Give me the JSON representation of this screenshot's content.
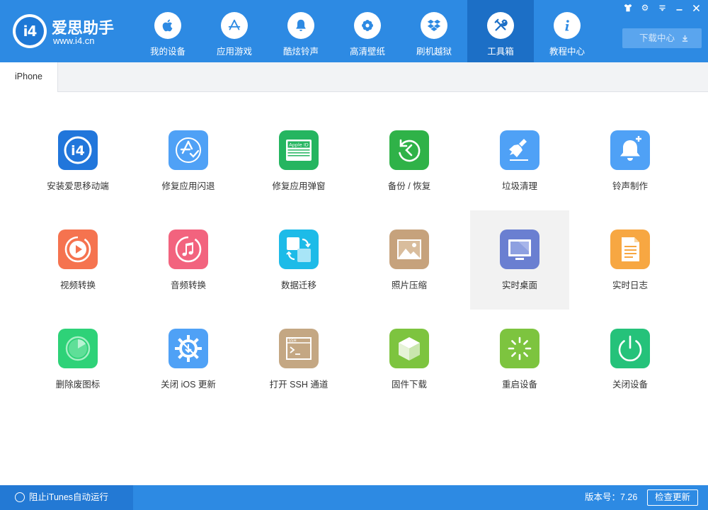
{
  "app": {
    "name": "爱思助手",
    "url": "www.i4.cn",
    "badge": "i4"
  },
  "nav": [
    {
      "label": "我的设备",
      "icon": "apple-icon"
    },
    {
      "label": "应用游戏",
      "icon": "app-store-icon"
    },
    {
      "label": "酷炫铃声",
      "icon": "bell-icon"
    },
    {
      "label": "高清壁纸",
      "icon": "flower-icon"
    },
    {
      "label": "刷机越狱",
      "icon": "dropbox-icon"
    },
    {
      "label": "工具箱",
      "icon": "tools-icon",
      "active": true
    },
    {
      "label": "教程中心",
      "icon": "info-icon"
    }
  ],
  "window_controls": [
    {
      "name": "skin-button",
      "glyph": "👕"
    },
    {
      "name": "settings-button",
      "glyph": "⚙"
    },
    {
      "name": "menu-button",
      "glyph": "≡"
    },
    {
      "name": "minimize-button",
      "glyph": "—"
    },
    {
      "name": "close-button",
      "glyph": "✕"
    }
  ],
  "download_center": {
    "label": "下载中心",
    "icon": "download-icon"
  },
  "tabs": [
    {
      "label": "iPhone",
      "active": true
    }
  ],
  "tools": [
    {
      "label": "安装爱思移动端",
      "icon": "i4-app-icon",
      "color": "#2176db"
    },
    {
      "label": "修复应用闪退",
      "icon": "app-store-repair-icon",
      "color": "#4fa1f6"
    },
    {
      "label": "修复应用弹窗",
      "icon": "apple-id-icon",
      "color": "#25b560",
      "badge_text": "Apple ID"
    },
    {
      "label": "备份 / 恢复",
      "icon": "backup-restore-icon",
      "color": "#2fb248"
    },
    {
      "label": "垃圾清理",
      "icon": "broom-icon",
      "color": "#4fa1f6"
    },
    {
      "label": "铃声制作",
      "icon": "bell-plus-icon",
      "color": "#4fa1f6"
    },
    {
      "label": "视频转换",
      "icon": "video-play-icon",
      "color": "#f5734f"
    },
    {
      "label": "音频转换",
      "icon": "music-note-icon",
      "color": "#f2637e"
    },
    {
      "label": "数据迁移",
      "icon": "data-migrate-icon",
      "color": "#1dbbe8"
    },
    {
      "label": "照片压缩",
      "icon": "photo-icon",
      "color": "#c6a27c"
    },
    {
      "label": "实时桌面",
      "icon": "monitor-icon",
      "color": "#6a7fd1",
      "hover": true
    },
    {
      "label": "实时日志",
      "icon": "document-icon",
      "color": "#f7a742"
    },
    {
      "label": "删除废图标",
      "icon": "pie-icon",
      "color": "#2ed278"
    },
    {
      "label": "关闭 iOS 更新",
      "icon": "gear-block-icon",
      "color": "#4fa1f6"
    },
    {
      "label": "打开 SSH 通道",
      "icon": "ssh-terminal-icon",
      "color": "#c4a783",
      "badge_text": "SSH"
    },
    {
      "label": "固件下载",
      "icon": "box-icon",
      "color": "#7dc43f"
    },
    {
      "label": "重启设备",
      "icon": "restart-spinner-icon",
      "color": "#7dc43f"
    },
    {
      "label": "关闭设备",
      "icon": "power-icon",
      "color": "#25c27a"
    }
  ],
  "footer": {
    "itunes_label": "阻止iTunes自动运行",
    "version": "版本号：7.26",
    "update_button": "检查更新"
  }
}
